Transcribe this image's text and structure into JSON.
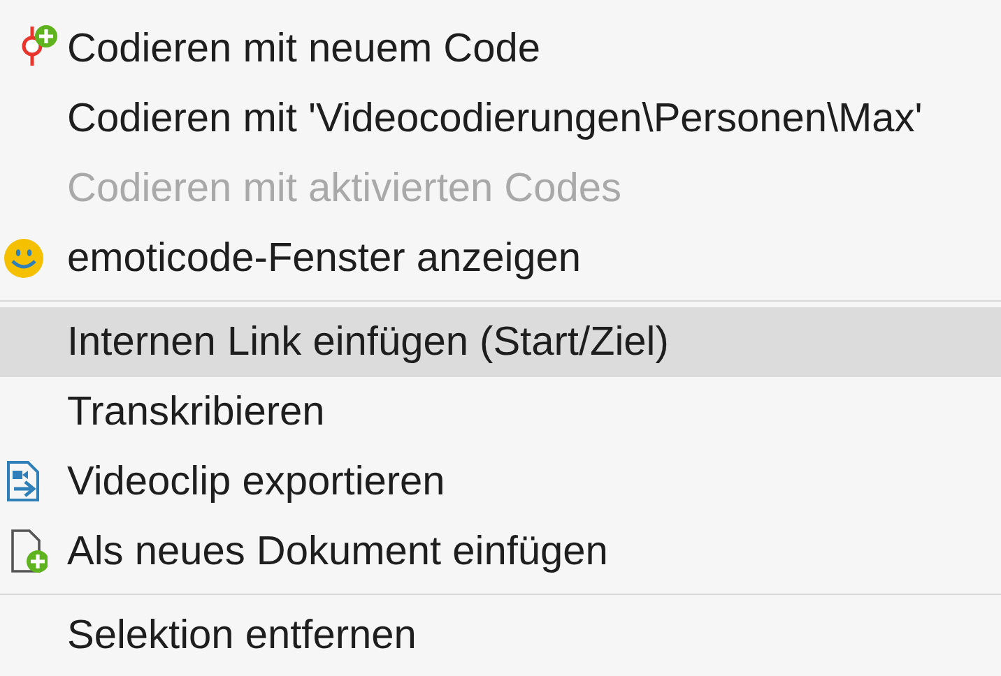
{
  "menu": {
    "items": [
      {
        "kind": "code-item",
        "label": "Codieren mit neuem Code",
        "disabled": false,
        "selected": false
      },
      {
        "kind": "item",
        "label": "Codieren mit 'Videocodierungen\\Personen\\Max'",
        "disabled": false,
        "selected": false
      },
      {
        "kind": "item",
        "label": "Codieren mit aktivierten Codes",
        "disabled": true,
        "selected": false
      },
      {
        "kind": "smiley-item",
        "label": "emoticode-Fenster anzeigen",
        "disabled": false,
        "selected": false
      },
      {
        "kind": "separator"
      },
      {
        "kind": "item",
        "label": "Internen Link einfügen (Start/Ziel)",
        "disabled": false,
        "selected": true
      },
      {
        "kind": "item",
        "label": "Transkribieren",
        "disabled": false,
        "selected": false
      },
      {
        "kind": "video-item",
        "label": "Videoclip exportieren",
        "disabled": false,
        "selected": false
      },
      {
        "kind": "document-item",
        "label": "Als neues Dokument einfügen",
        "disabled": false,
        "selected": false
      },
      {
        "kind": "separator"
      },
      {
        "kind": "item",
        "label": "Selektion entfernen",
        "disabled": false,
        "selected": false
      }
    ]
  }
}
